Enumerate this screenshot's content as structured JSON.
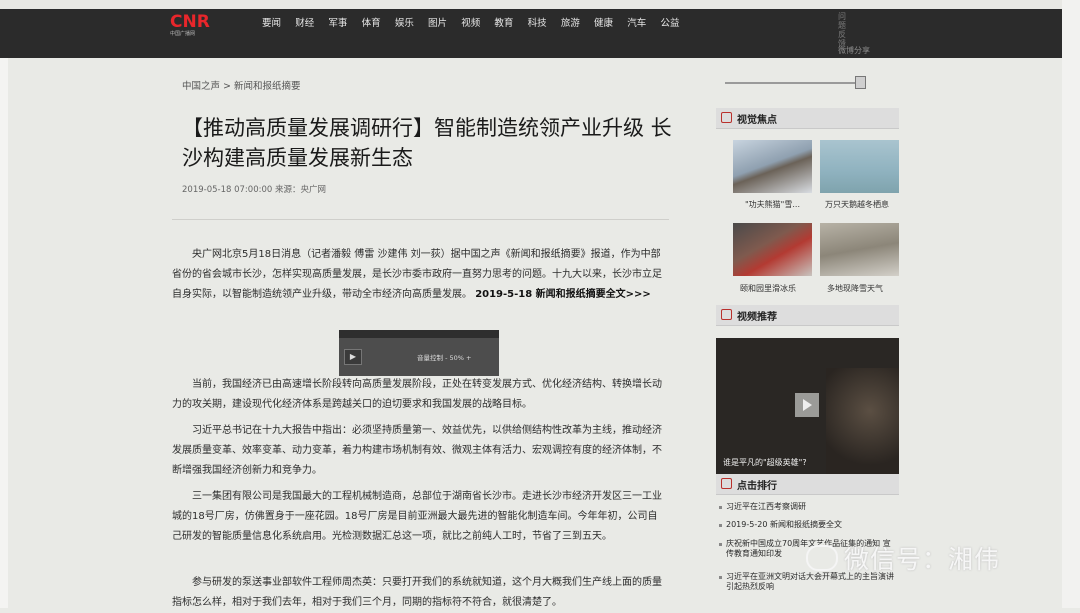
{
  "header": {
    "logo_text": "CNR",
    "logo_sub": "中国广播网",
    "nav": [
      "要闻",
      "财经",
      "军事",
      "体育",
      "娱乐",
      "图片",
      "视频",
      "教育",
      "科技",
      "旅游",
      "健康",
      "汽车",
      "公益"
    ],
    "tools_vertical": "问题反馈",
    "tools_label": "微博分享"
  },
  "article": {
    "breadcrumb": "中国之声 > 新闻和报纸摘要",
    "title": "【推动高质量发展调研行】智能制造统领产业升级 长沙构建高质量发展新生态",
    "meta": "2019-05-18 07:00:00  来源：央广网",
    "p1": "央广网北京5月18日消息（记者潘毅 傅雷 沙建伟 刘一荻）据中国之声《新闻和报纸摘要》报道，作为中部省份的省会城市长沙，怎样实现高质量发展，是长沙市委市政府一直努力思考的问题。十九大以来，长沙市立足自身实际，以智能制造统领产业升级，带动全市经济向高质量发展。",
    "p1_bold": "2019-5-18 新闻和报纸摘要全文>>>",
    "player": {
      "play_icon": "play-icon",
      "volume_label": "音量控制",
      "volume_value": "50%"
    },
    "p2": "当前，我国经济已由高速增长阶段转向高质量发展阶段，正处在转变发展方式、优化经济结构、转换增长动力的攻关期，建设现代化经济体系是跨越关口的迫切要求和我国发展的战略目标。",
    "p3": "习近平总书记在十九大报告中指出：必须坚持质量第一、效益优先，以供给侧结构性改革为主线，推动经济发展质量变革、效率变革、动力变革，着力构建市场机制有效、微观主体有活力、宏观调控有度的经济体制，不断增强我国经济创新力和竞争力。",
    "p4": "三一集团有限公司是我国最大的工程机械制造商，总部位于湖南省长沙市。走进长沙市经济开发区三一工业城的18号厂房，仿佛置身于一座花园。18号厂房是目前亚洲最大最先进的智能化制造车间。今年年初，公司自己研发的智能质量信息化系统启用。光检测数据汇总这一项，就比之前纯人工时，节省了三到五天。",
    "p5": "参与研发的泵送事业部软件工程师周杰英：只要打开我们的系统就知道，这个月大概我们生产线上面的质量指标怎么样，相对于我们去年，相对于我们三个月，同期的指标符不符合，就很清楚了。"
  },
  "sidebar": {
    "visual_focus": {
      "title": "视觉焦点",
      "items": [
        "\"功夫熊猫\"雪...",
        "万只天鹅越冬栖息",
        "颐和园里滑冰乐",
        "多地现降雪天气"
      ]
    },
    "video_rec": {
      "title": "视频推荐",
      "caption": "谁是平凡的\"超级英雄\"?"
    },
    "ranking": {
      "title": "点击排行",
      "items": [
        "习近平在江西考察调研",
        "2019-5-20 新闻和报纸摘要全文",
        "庆祝新中国成立70周年文艺作品征集的通知 宣传教育通知印发",
        "习近平在亚洲文明对话大会开幕式上的主旨演讲引起热烈反响"
      ]
    }
  },
  "watermark": {
    "text": "微信号：湘伟"
  },
  "colors": {
    "brand_red": "#e8262b",
    "header_bg": "#2b2b2b",
    "page_bg": "#e9eae6"
  }
}
